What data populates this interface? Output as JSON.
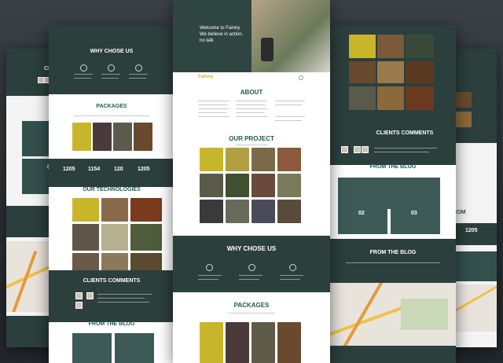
{
  "center": {
    "hero_text": "Welcome to Fainny\nWe believe in action,\nno talk",
    "logo_text": "Fainny",
    "about_title": "ABOUT",
    "project_title": "OUR PROJECT",
    "why_title": "WHY CHOSE US",
    "packages_title": "PACKAGES"
  },
  "left_main": {
    "why_title": "WHY CHOSE US",
    "packages_title": "PACKAGES",
    "stats": [
      {
        "value": "1205"
      },
      {
        "value": "1154"
      },
      {
        "value": "120"
      },
      {
        "value": "1205"
      }
    ],
    "tech_title": "OUR TECHNOLOGIES",
    "clients_title": "CLIENTS COMMENTS",
    "blog_title": "FROM THE BLOG"
  },
  "left_back": {
    "cut_title_1": "CLI",
    "cut_title_2": "FR",
    "blog_num": "02"
  },
  "right_main": {
    "clients_title": "CLIENTS COMMENTS",
    "blog_title": "FROM THE BLOG",
    "blog_nums": [
      "02",
      "03"
    ],
    "blog2_title": "FROM THE BLOG"
  },
  "right_back": {
    "cut_title": "FROM",
    "stat_value": "1205"
  },
  "colors": {
    "dark": "#2b3f3d",
    "accent": "#1e5a56",
    "yellow": "#c9b52a"
  }
}
